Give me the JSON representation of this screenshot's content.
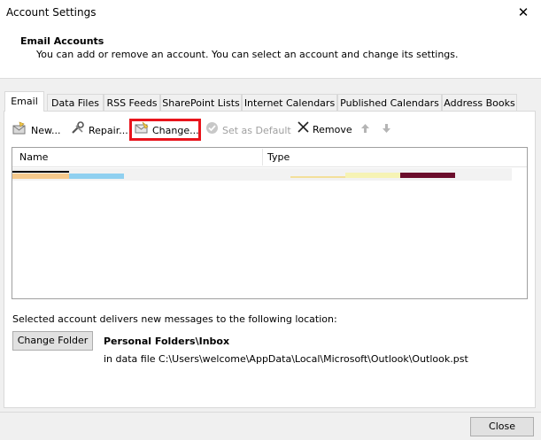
{
  "window": {
    "title": "Account Settings",
    "close_glyph": "✕"
  },
  "header": {
    "title": "Email Accounts",
    "subtitle": "You can add or remove an account. You can select an account and change its settings."
  },
  "tabs": [
    {
      "label": "Email",
      "active": true
    },
    {
      "label": "Data Files"
    },
    {
      "label": "RSS Feeds"
    },
    {
      "label": "SharePoint Lists"
    },
    {
      "label": "Internet Calendars"
    },
    {
      "label": "Published Calendars"
    },
    {
      "label": "Address Books"
    }
  ],
  "toolbar": {
    "new_label": "New...",
    "repair_label": "Repair...",
    "change_label": "Change...",
    "set_default_label": "Set as Default",
    "remove_label": "Remove"
  },
  "list": {
    "col_name": "Name",
    "col_type": "Type"
  },
  "delivery": {
    "label": "Selected account delivers new messages to the following location:",
    "change_folder_label": "Change Folder",
    "folder": "Personal Folders\\Inbox",
    "data_file": "in data file C:\\Users\\welcome\\AppData\\Local\\Microsoft\\Outlook\\Outlook.pst"
  },
  "footer": {
    "close_label": "Close"
  },
  "colors": {
    "highlight": "#e8141c",
    "redact_1": "#f5c98c",
    "redact_2": "#8fd0f0",
    "redact_3": "#f3df9a",
    "redact_4": "#f6f3b4",
    "redact_5": "#6b0d2c"
  }
}
